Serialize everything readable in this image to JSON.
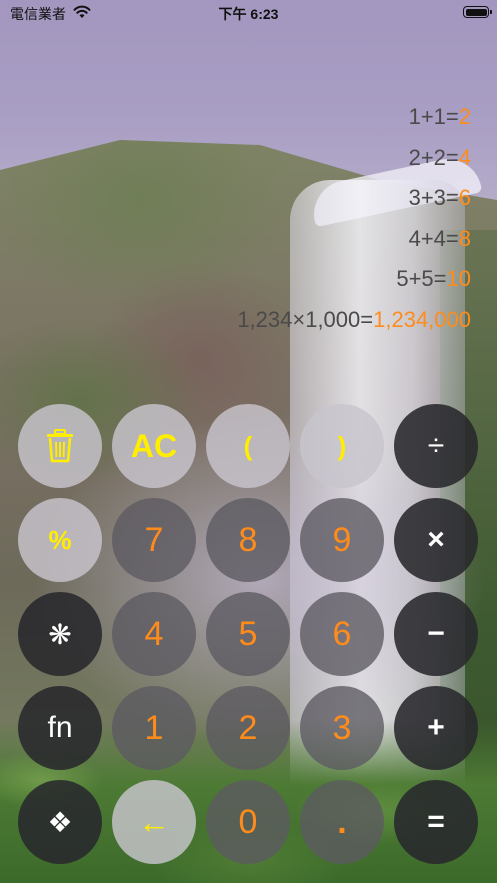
{
  "status_bar": {
    "carrier": "電信業者",
    "time": "下午 6:23"
  },
  "history": [
    {
      "expr": "1+1=",
      "result": "2"
    },
    {
      "expr": "2+2=",
      "result": "4"
    },
    {
      "expr": "3+3=",
      "result": "6"
    },
    {
      "expr": "4+4=",
      "result": "8"
    },
    {
      "expr": "5+5=",
      "result": "10"
    },
    {
      "expr": "1,234×1,000=",
      "result": "1,234,000"
    }
  ],
  "keys": {
    "trash": "🗑",
    "ac": "AC",
    "open_paren": "(",
    "close_paren": ")",
    "divide": "÷",
    "percent": "%",
    "seven": "7",
    "eight": "8",
    "nine": "9",
    "multiply": "×",
    "asterisk": "❋",
    "four": "4",
    "five": "5",
    "six": "6",
    "minus": "−",
    "fn": "fn",
    "one": "1",
    "two": "2",
    "three": "3",
    "plus": "+",
    "diamond": "❖",
    "backspace": "←",
    "zero": "0",
    "dot": ".",
    "equals": "="
  },
  "colors": {
    "result": "#ff8c1a",
    "function_key": "#ffee00",
    "digit": "#ff8c1a"
  }
}
